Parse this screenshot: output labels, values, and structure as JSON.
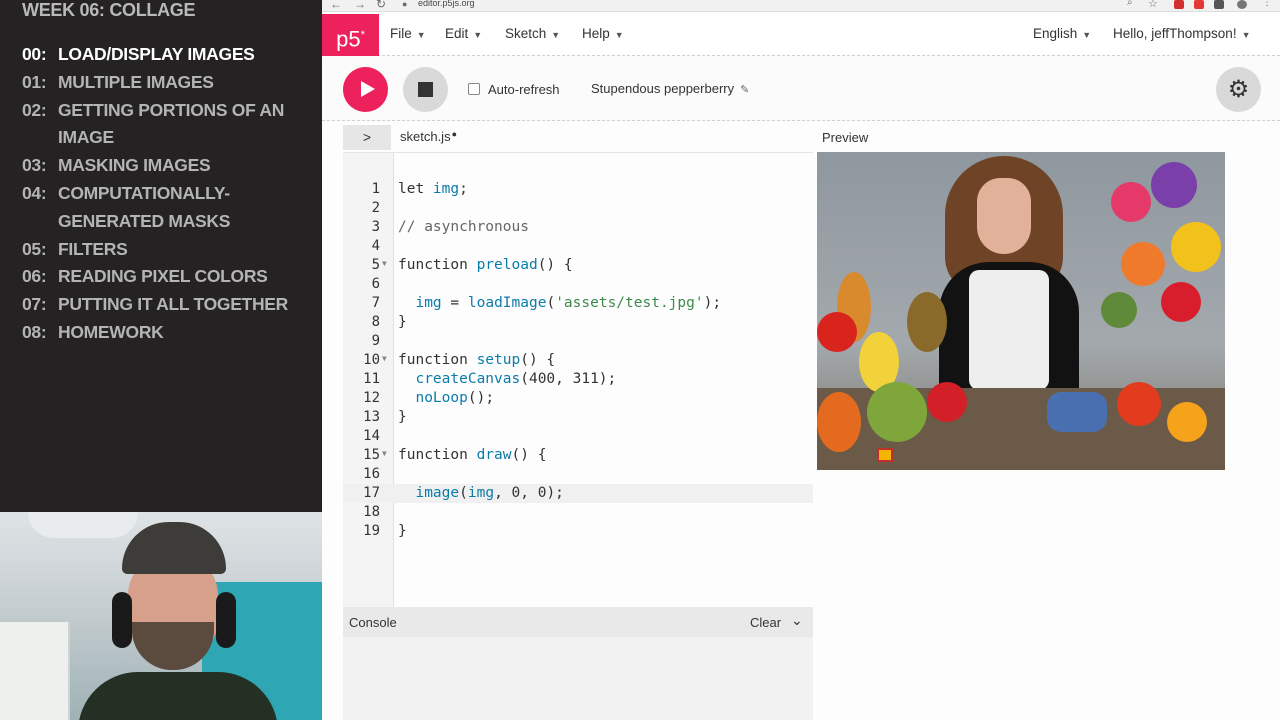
{
  "lesson": {
    "title": "WEEK 06: COLLAGE",
    "items": [
      {
        "num": "00:",
        "label": "LOAD/DISPLAY IMAGES"
      },
      {
        "num": "01:",
        "label": "MULTIPLE IMAGES"
      },
      {
        "num": "02:",
        "label": "GETTING PORTIONS OF AN IMAGE"
      },
      {
        "num": "03:",
        "label": "MASKING IMAGES"
      },
      {
        "num": "04:",
        "label": "COMPUTATIONALLY-GENERATED MASKS"
      },
      {
        "num": "05:",
        "label": "FILTERS"
      },
      {
        "num": "06:",
        "label": "READING PIXEL COLORS"
      },
      {
        "num": "07:",
        "label": "PUTTING IT ALL TOGETHER"
      },
      {
        "num": "08:",
        "label": "HOMEWORK"
      }
    ]
  },
  "browser": {
    "url": "editor.p5js.org"
  },
  "nav": {
    "logo": "p5",
    "logo_sup": "*",
    "file": "File",
    "edit": "Edit",
    "sketch": "Sketch",
    "help": "Help",
    "language": "English",
    "user": "Hello, jeffThompson!"
  },
  "toolbar": {
    "auto_refresh_label": "Auto-refresh",
    "sketch_name": "Stupendous pepperberry"
  },
  "editor": {
    "file_tab": "sketch.js",
    "unsaved_marker": "●",
    "preview_label": "Preview",
    "lines": [
      {
        "n": "1",
        "fold": false,
        "tokens": [
          {
            "t": "let ",
            "c": "k"
          },
          {
            "t": "img",
            "c": "f"
          },
          {
            "t": ";",
            "c": "n"
          }
        ]
      },
      {
        "n": "2",
        "fold": false,
        "tokens": []
      },
      {
        "n": "3",
        "fold": false,
        "tokens": [
          {
            "t": "// asynchronous",
            "c": "c"
          }
        ]
      },
      {
        "n": "4",
        "fold": false,
        "tokens": []
      },
      {
        "n": "5",
        "fold": true,
        "tokens": [
          {
            "t": "function ",
            "c": "k"
          },
          {
            "t": "preload",
            "c": "f"
          },
          {
            "t": "() {",
            "c": "n"
          }
        ]
      },
      {
        "n": "6",
        "fold": false,
        "tokens": []
      },
      {
        "n": "7",
        "fold": false,
        "tokens": [
          {
            "t": "  ",
            "c": "n"
          },
          {
            "t": "img",
            "c": "f"
          },
          {
            "t": " = ",
            "c": "n"
          },
          {
            "t": "loadImage",
            "c": "f"
          },
          {
            "t": "(",
            "c": "n"
          },
          {
            "t": "'assets/test.jpg'",
            "c": "s"
          },
          {
            "t": ");",
            "c": "n"
          }
        ]
      },
      {
        "n": "8",
        "fold": false,
        "tokens": [
          {
            "t": "}",
            "c": "n"
          }
        ]
      },
      {
        "n": "9",
        "fold": false,
        "tokens": []
      },
      {
        "n": "10",
        "fold": true,
        "tokens": [
          {
            "t": "function ",
            "c": "k"
          },
          {
            "t": "setup",
            "c": "f"
          },
          {
            "t": "() {",
            "c": "n"
          }
        ]
      },
      {
        "n": "11",
        "fold": false,
        "tokens": [
          {
            "t": "  ",
            "c": "n"
          },
          {
            "t": "createCanvas",
            "c": "f"
          },
          {
            "t": "(400, 311);",
            "c": "n"
          }
        ]
      },
      {
        "n": "12",
        "fold": false,
        "tokens": [
          {
            "t": "  ",
            "c": "n"
          },
          {
            "t": "noLoop",
            "c": "f"
          },
          {
            "t": "();",
            "c": "n"
          }
        ]
      },
      {
        "n": "13",
        "fold": false,
        "tokens": [
          {
            "t": "}",
            "c": "n"
          }
        ]
      },
      {
        "n": "14",
        "fold": false,
        "tokens": []
      },
      {
        "n": "15",
        "fold": true,
        "tokens": [
          {
            "t": "function ",
            "c": "k"
          },
          {
            "t": "draw",
            "c": "f"
          },
          {
            "t": "() {",
            "c": "n"
          }
        ]
      },
      {
        "n": "16",
        "fold": false,
        "tokens": []
      },
      {
        "n": "17",
        "fold": false,
        "highlight": true,
        "tokens": [
          {
            "t": "  ",
            "c": "n"
          },
          {
            "t": "image",
            "c": "f"
          },
          {
            "t": "(",
            "c": "n"
          },
          {
            "t": "img",
            "c": "f"
          },
          {
            "t": ", 0, 0);",
            "c": "n"
          }
        ]
      },
      {
        "n": "18",
        "fold": false,
        "tokens": []
      },
      {
        "n": "19",
        "fold": false,
        "tokens": [
          {
            "t": "}",
            "c": "n"
          }
        ]
      }
    ]
  },
  "console": {
    "title": "Console",
    "clear": "Clear"
  },
  "colors": {
    "accent": "#ed225d",
    "function_token": "#0b7ca9",
    "string_token": "#3d8b4a"
  }
}
